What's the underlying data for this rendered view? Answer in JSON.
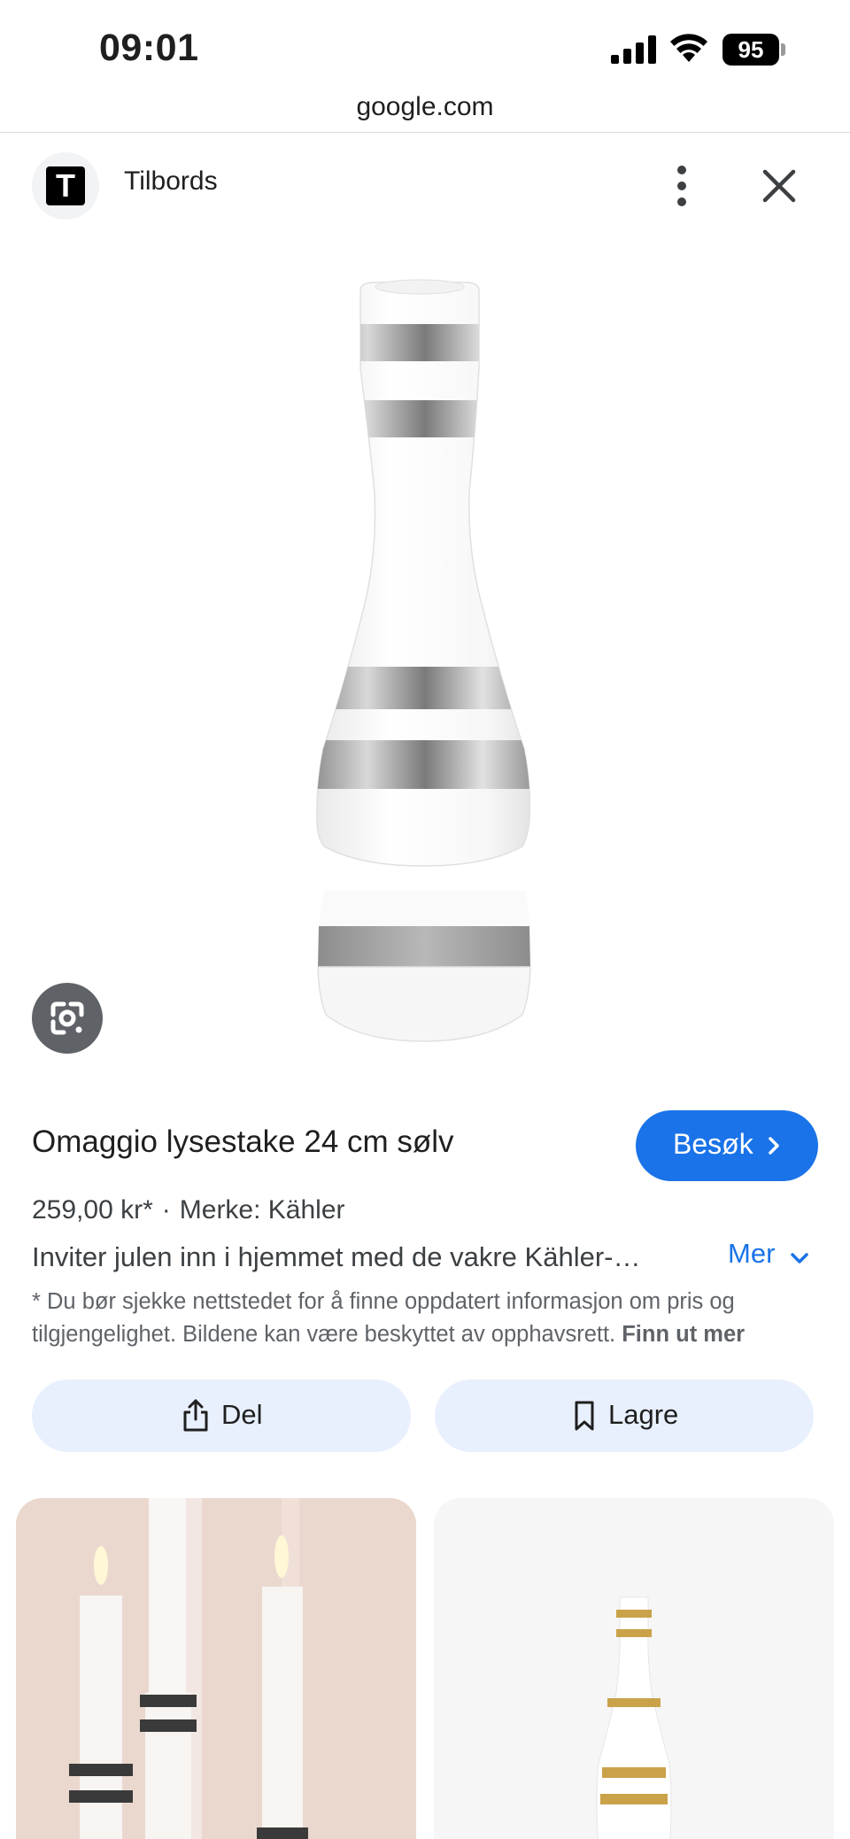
{
  "status": {
    "time": "09:01",
    "battery": "95"
  },
  "browser": {
    "url": "google.com"
  },
  "site": {
    "logo_letter": "T",
    "name": "Tilbords"
  },
  "product": {
    "title": "Omaggio lysestake 24 cm sølv",
    "visit_label": "Besøk",
    "price": "259,00 kr*",
    "separator": "·",
    "brand": "Merke: Kähler",
    "description": "Inviter julen inn i hjemmet med de vakre Kähler-…",
    "more_label": "Mer",
    "disclaimer": "* Du bør sjekke nettstedet for å finne oppdatert informasjon om pris og tilgjengelighet. Bildene kan være beskyttet av opphavsrett.",
    "disclaimer_link": "Finn ut mer"
  },
  "actions": {
    "share_label": "Del",
    "save_label": "Lagre"
  },
  "colors": {
    "accent": "#1a73e8",
    "action_bg": "#e8f0fe",
    "lens_bg": "#5f6368"
  },
  "icons": {
    "more": "more-vert-icon",
    "close": "close-icon",
    "lens": "google-lens-icon",
    "share": "share-icon",
    "save": "bookmark-icon"
  }
}
